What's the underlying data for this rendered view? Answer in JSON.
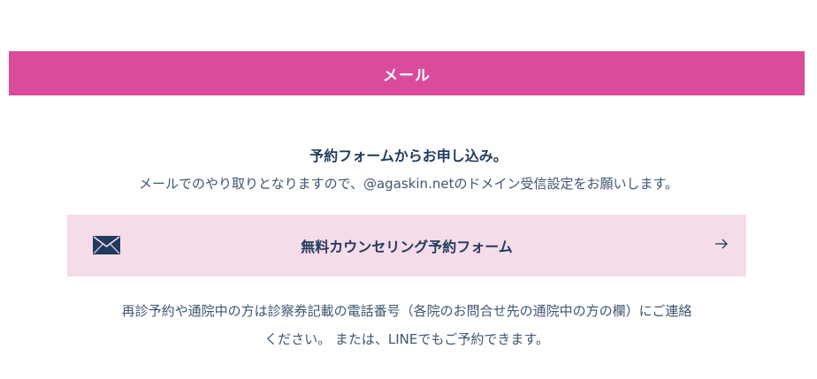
{
  "header": {
    "title": "メール"
  },
  "intro": {
    "title": "予約フォームからお申し込み。",
    "description": "メールでのやり取りとなりますので、@agaskin.netのドメイン受信設定をお願いします。"
  },
  "cta": {
    "label": "無料カウンセリング予約フォーム",
    "icon": "mail-icon",
    "arrow_icon": "arrow-right-icon",
    "background": "#f6dbe9"
  },
  "note": {
    "line1": "再診予約や通院中の方は診察券記載の電話番号（各院のお問合せ先の通院中の方の欄）にご連絡",
    "line2": "ください。 または、LINEでもご予約できます。"
  },
  "colors": {
    "accent": "#da4b9b",
    "text": "#1f3b5e"
  }
}
